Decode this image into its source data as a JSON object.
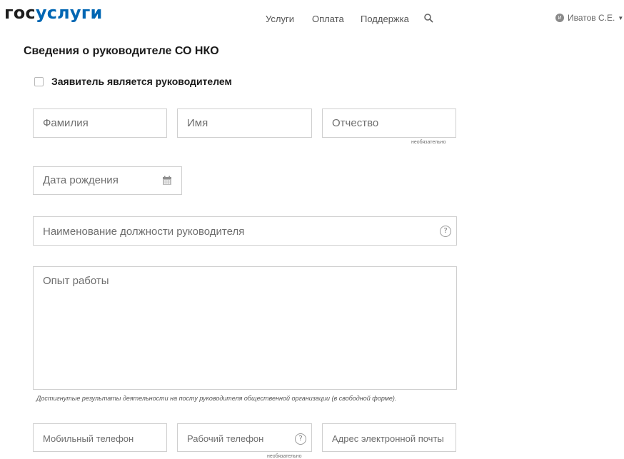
{
  "header": {
    "logo_part1": "гос",
    "logo_part2": "услуги",
    "nav": [
      "Услуги",
      "Оплата",
      "Поддержка"
    ],
    "search_icon": "search-icon",
    "user": {
      "avatar_initial": "И",
      "name": "Иватов С.Е."
    }
  },
  "form": {
    "title": "Сведения о руководителе СО НКО",
    "checkbox_label": "Заявитель является руководителем",
    "checkbox_checked": false,
    "lastname_placeholder": "Фамилия",
    "firstname_placeholder": "Имя",
    "patronymic_placeholder": "Отчество",
    "optional_label": "необязательно",
    "birthdate_placeholder": "Дата рождения",
    "calendar_icon": "calendar-icon",
    "position_placeholder": "Наименование должности руководителя",
    "info_icon": "info-icon",
    "experience_placeholder": "Опыт работы",
    "experience_hint": "Достигнутые результаты деятельности на посту руководителя общественной организации (в свободной форме).",
    "mobile_placeholder": "Мобильный телефон",
    "work_phone_placeholder": "Рабочий телефон",
    "email_placeholder": "Адрес электронной почты"
  },
  "colors": {
    "brand_blue": "#0066b3",
    "border": "#cfcfcf",
    "placeholder": "#6e6e6e"
  }
}
